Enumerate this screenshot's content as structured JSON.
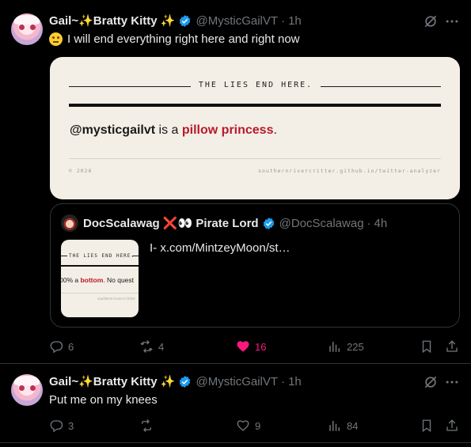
{
  "tweets": [
    {
      "display_name": "Gail~✨Bratty Kitty ✨",
      "handle": "@MysticGailVT",
      "time": "1h",
      "text": "I will end everything right here and right now",
      "card": {
        "title": "THE LIES END HERE.",
        "user": "@mysticgailvt",
        "middle": " is a ",
        "highlight": "pillow princess",
        "end": ".",
        "copyright": "© 2026",
        "url": "southernrivercritter.github.io/twitter-analyzer"
      },
      "quote": {
        "display_name": "DocScalawag ❌👀 Pirate Lord",
        "handle": "@DocScalawag",
        "time": "4h",
        "text": "I-  x.com/MintzeyMoon/st…",
        "thumb": {
          "title": "THE LIES END HERE.",
          "before": "00% a ",
          "highlight": "bottom",
          "after": ". No quest",
          "url": "southernrivercritter"
        }
      },
      "actions": {
        "replies": "6",
        "reposts": "4",
        "likes": "16",
        "views": "225"
      }
    },
    {
      "display_name": "Gail~✨Bratty Kitty ✨",
      "handle": "@MysticGailVT",
      "time": "1h",
      "text": "Put me on my knees",
      "actions": {
        "replies": "3",
        "reposts": "",
        "likes": "9",
        "views": "84"
      }
    }
  ],
  "colors": {
    "accent_like": "#f91880",
    "verified": "#1d9bf0",
    "muted": "#71767b",
    "highlight": "#b8192b"
  },
  "icons": [
    "verified-badge-icon",
    "grok-icon",
    "more-icon",
    "reply-icon",
    "repost-icon",
    "like-icon",
    "views-icon",
    "bookmark-icon",
    "share-icon"
  ]
}
